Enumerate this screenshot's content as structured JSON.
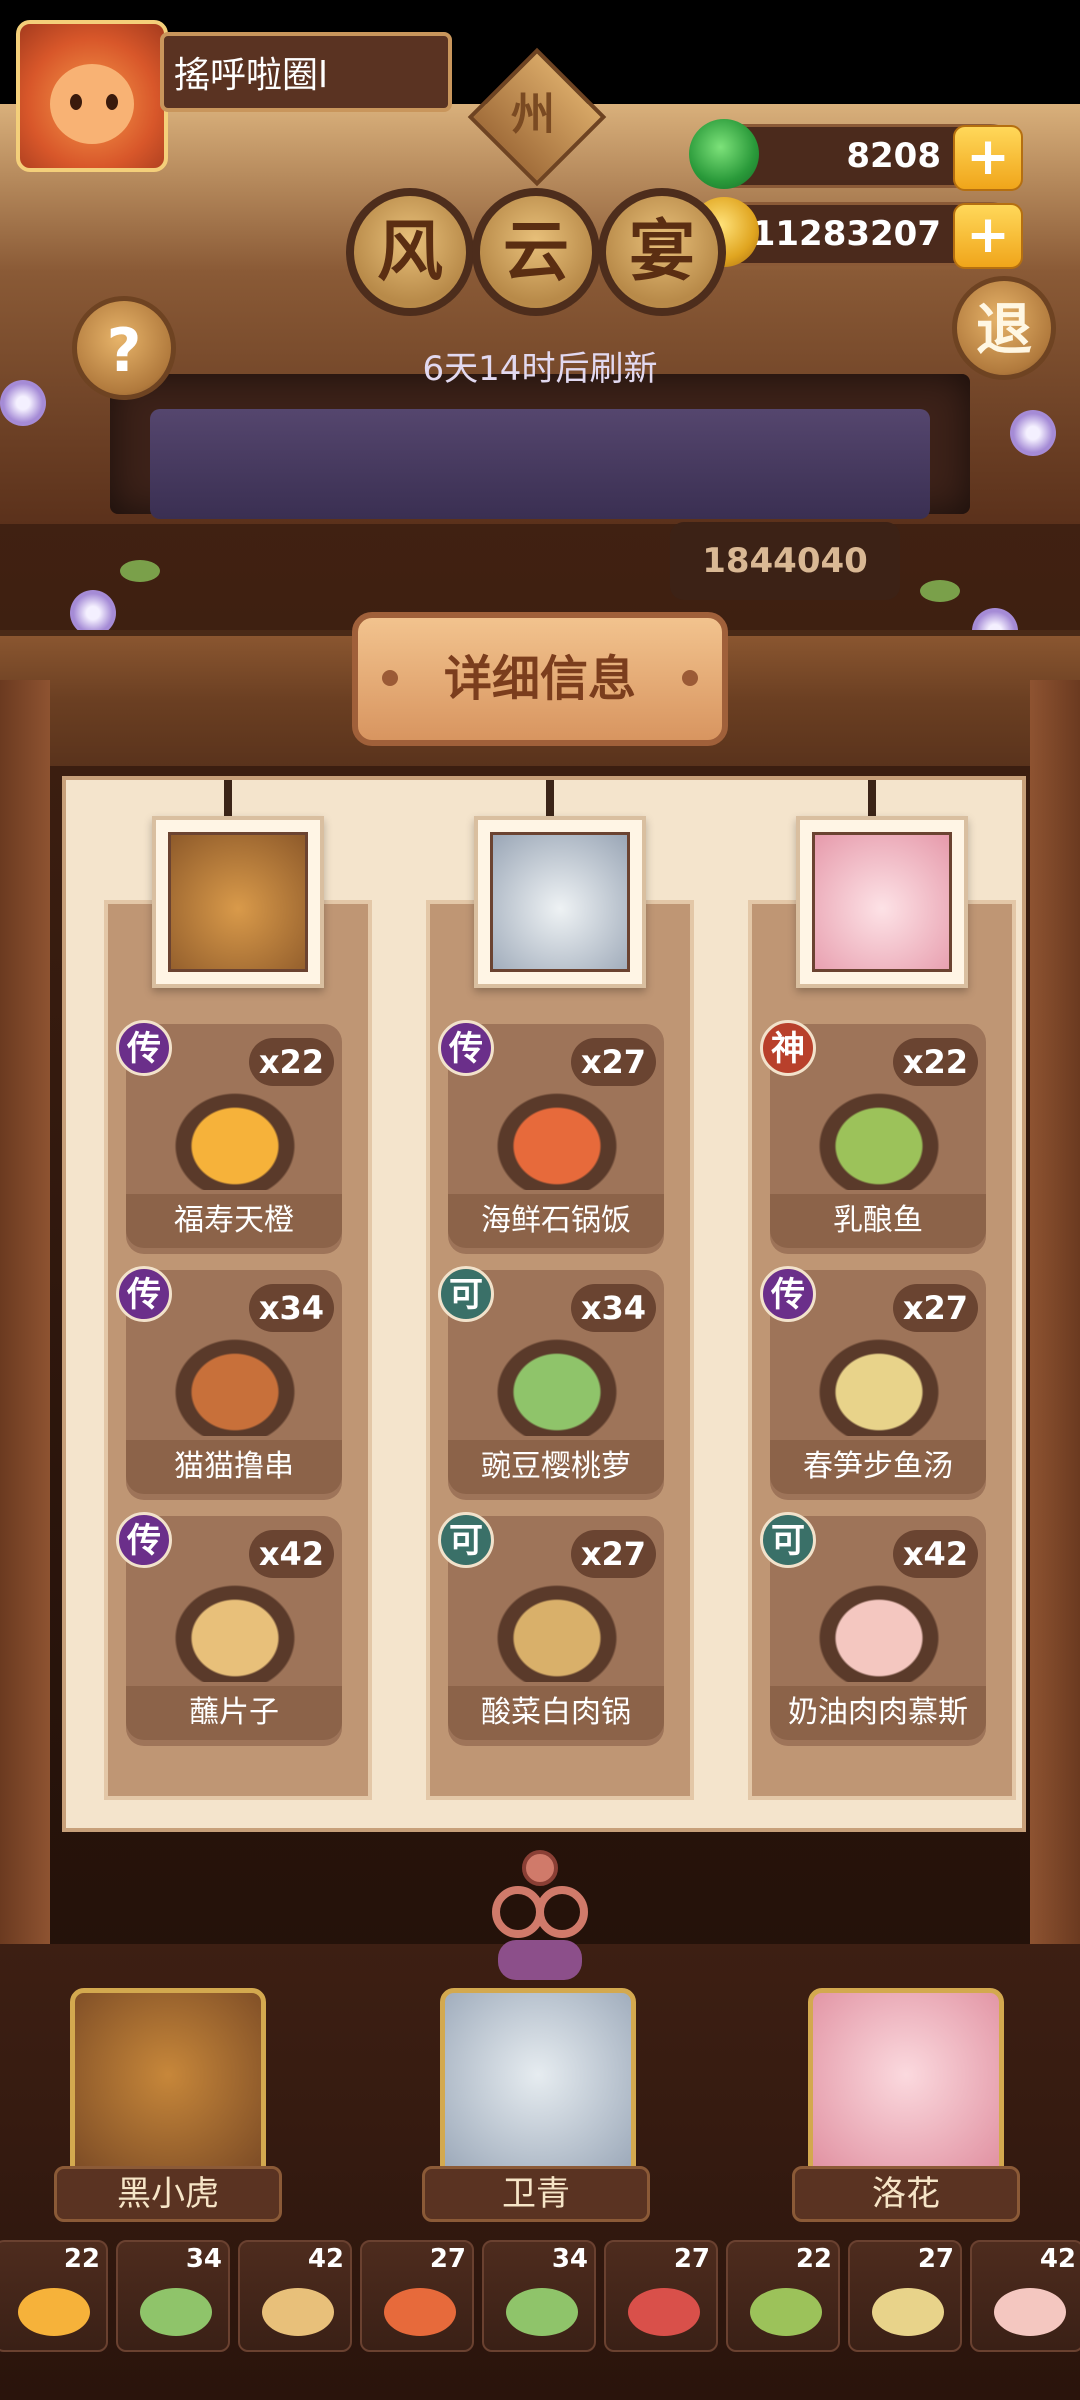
{
  "player": {
    "name": "搖呼啦圈l"
  },
  "resources": {
    "jade": "8208",
    "coins": "11283207"
  },
  "region_badge": "州",
  "event": {
    "title_chars": [
      "风",
      "云",
      "宴"
    ],
    "refresh_text": "6天14时后刷新",
    "score": "1844040"
  },
  "buttons": {
    "help": "?",
    "exit": "退"
  },
  "panel_title": "详细信息",
  "columns": [
    {
      "dishes": [
        {
          "grade": "传",
          "grade_type": "chuan",
          "qty": "x22",
          "name": "福寿天橙"
        },
        {
          "grade": "传",
          "grade_type": "chuan",
          "qty": "x34",
          "name": "猫猫撸串"
        },
        {
          "grade": "传",
          "grade_type": "chuan",
          "qty": "x42",
          "name": "蘸片子"
        }
      ]
    },
    {
      "dishes": [
        {
          "grade": "传",
          "grade_type": "chuan",
          "qty": "x27",
          "name": "海鲜石锅饭"
        },
        {
          "grade": "可",
          "grade_type": "ke",
          "qty": "x34",
          "name": "豌豆樱桃萝"
        },
        {
          "grade": "可",
          "grade_type": "ke",
          "qty": "x27",
          "name": "酸菜白肉锅"
        }
      ]
    },
    {
      "dishes": [
        {
          "grade": "神",
          "grade_type": "shen",
          "qty": "x22",
          "name": "乳酿鱼"
        },
        {
          "grade": "传",
          "grade_type": "chuan",
          "qty": "x27",
          "name": "春笋步鱼汤"
        },
        {
          "grade": "可",
          "grade_type": "ke",
          "qty": "x42",
          "name": "奶油肉肉慕斯"
        }
      ]
    }
  ],
  "characters": [
    {
      "name": "黑小虎"
    },
    {
      "name": "卫青"
    },
    {
      "name": "洛花"
    }
  ],
  "slots": [
    "22",
    "34",
    "42",
    "27",
    "34",
    "27",
    "22",
    "27",
    "42"
  ],
  "colors": {
    "grade_chuan": "#6b2f8a",
    "grade_shen": "#b8402b",
    "grade_ke": "#3a7068",
    "gold": "#f0a51a"
  }
}
